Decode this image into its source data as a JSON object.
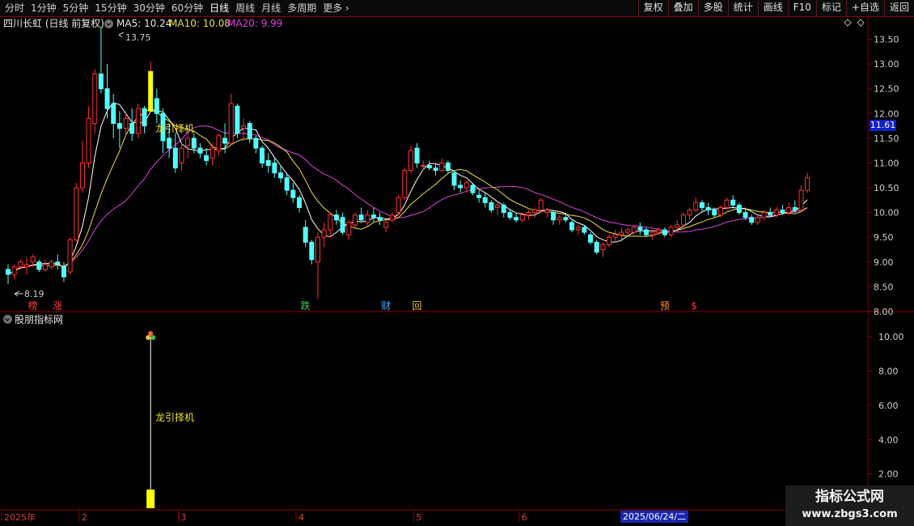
{
  "toolbar": {
    "periods": [
      "分时",
      "1分钟",
      "5分钟",
      "15分钟",
      "30分钟",
      "60分钟",
      "日线",
      "周线",
      "月线",
      "多周期",
      "更多"
    ],
    "active_period": "日线",
    "tools": [
      "复权",
      "叠加",
      "多股",
      "统计",
      "画线",
      "F10",
      "标记",
      "+自选",
      "返回"
    ]
  },
  "header": {
    "stock_title": "四川长虹 (日线 前复权)",
    "ma5": "MA5: 10.24",
    "ma10": "MA10: 10.08",
    "ma20": "MA20: 9.99"
  },
  "main": {
    "max_label": "13.75",
    "min_label": "8.19",
    "annotation": "龙引择机",
    "price_tag": "11.61",
    "markers": [
      {
        "char": "榜",
        "color": "#ff4040",
        "i": 4
      },
      {
        "char": "涨",
        "color": "#ff4040",
        "i": 8
      },
      {
        "char": "跌",
        "color": "#44d050",
        "i": 48
      },
      {
        "char": "财",
        "color": "#44aaff",
        "i": 61
      },
      {
        "char": "回",
        "color": "#e8c040",
        "i": 66
      },
      {
        "char": "预",
        "color": "#ff9030",
        "i": 106
      },
      {
        "char": "$",
        "color": "#ff3030",
        "i": 111
      }
    ]
  },
  "sub": {
    "title": "股朋指标网",
    "annotation": "龙引择机",
    "signal_i": 23
  },
  "axis": {
    "date_labels": [
      {
        "text": "2025年",
        "i": 0
      },
      {
        "text": "2",
        "i": 12
      },
      {
        "text": "3",
        "i": 28
      },
      {
        "text": "4",
        "i": 47
      },
      {
        "text": "5",
        "i": 66
      },
      {
        "text": "6",
        "i": 83
      }
    ],
    "date_badge": "2025/06/24/二"
  },
  "watermark": {
    "title": "指标公式网",
    "url": "www.zbgs3.com"
  },
  "colors": {
    "up": "#ff3232",
    "down": "#54fcfc",
    "ma5": "#ffffff",
    "ma10": "#f0e040",
    "ma20": "#e040e0",
    "grid": "#8b0000",
    "signal": "#ffff00"
  },
  "chart_data": {
    "type": "candlestick",
    "price_axis": {
      "ticks": [
        8.0,
        8.5,
        9.0,
        9.5,
        10.0,
        10.5,
        11.0,
        11.5,
        12.0,
        12.5,
        13.0,
        13.5
      ],
      "range": [
        7.95,
        13.95
      ]
    },
    "indicator_axis": {
      "ticks": [
        2.0,
        4.0,
        6.0,
        8.0,
        10.0
      ],
      "range": [
        0,
        11
      ]
    },
    "signal_value": 10,
    "candles": [
      [
        8.85,
        8.95,
        8.55,
        8.75
      ],
      [
        8.75,
        8.95,
        8.65,
        8.9
      ],
      [
        8.9,
        9.05,
        8.85,
        9.0
      ],
      [
        8.9,
        9.1,
        8.75,
        8.95
      ],
      [
        9.0,
        9.15,
        8.9,
        9.1
      ],
      [
        9.0,
        9.05,
        8.8,
        8.85
      ],
      [
        8.85,
        9.05,
        8.8,
        8.95
      ],
      [
        8.9,
        9.05,
        8.85,
        9.0
      ],
      [
        9.0,
        9.15,
        8.85,
        8.95
      ],
      [
        8.9,
        9.0,
        8.6,
        8.7
      ],
      [
        8.8,
        9.5,
        8.75,
        9.45
      ],
      [
        9.45,
        10.6,
        9.4,
        10.5
      ],
      [
        10.5,
        11.45,
        10.4,
        11.0
      ],
      [
        11.0,
        12.15,
        10.9,
        11.9
      ],
      [
        11.8,
        12.9,
        11.6,
        12.8
      ],
      [
        12.8,
        13.75,
        12.4,
        12.5
      ],
      [
        12.5,
        13.0,
        11.9,
        12.1
      ],
      [
        12.2,
        12.4,
        11.5,
        11.8
      ],
      [
        11.8,
        12.05,
        11.3,
        11.7
      ],
      [
        11.7,
        12.05,
        11.55,
        11.9
      ],
      [
        11.8,
        12.1,
        11.45,
        11.6
      ],
      [
        11.6,
        12.2,
        11.5,
        12.1
      ],
      [
        12.1,
        12.15,
        11.6,
        11.75
      ],
      [
        12.05,
        13.05,
        12.05,
        12.85
      ],
      [
        12.3,
        12.5,
        11.8,
        12.0
      ],
      [
        12.0,
        12.1,
        11.2,
        11.45
      ],
      [
        11.5,
        11.8,
        11.1,
        11.3
      ],
      [
        11.3,
        11.6,
        10.8,
        10.9
      ],
      [
        11.0,
        11.4,
        10.85,
        11.3
      ],
      [
        11.35,
        11.6,
        11.1,
        11.5
      ],
      [
        11.5,
        11.6,
        11.2,
        11.3
      ],
      [
        11.3,
        11.4,
        11.1,
        11.2
      ],
      [
        11.15,
        11.3,
        10.95,
        11.05
      ],
      [
        11.1,
        11.4,
        10.95,
        11.3
      ],
      [
        11.25,
        11.6,
        11.15,
        11.55
      ],
      [
        11.5,
        11.8,
        11.2,
        11.4
      ],
      [
        11.4,
        12.4,
        11.35,
        12.2
      ],
      [
        12.15,
        12.2,
        11.5,
        11.6
      ],
      [
        11.7,
        11.9,
        11.45,
        11.75
      ],
      [
        11.8,
        11.85,
        11.4,
        11.5
      ],
      [
        11.5,
        11.55,
        11.2,
        11.3
      ],
      [
        11.3,
        11.35,
        10.9,
        11.0
      ],
      [
        11.05,
        11.2,
        10.8,
        10.95
      ],
      [
        11.0,
        11.1,
        10.7,
        10.8
      ],
      [
        10.8,
        10.95,
        10.6,
        10.7
      ],
      [
        10.7,
        10.8,
        10.35,
        10.45
      ],
      [
        10.45,
        10.6,
        10.2,
        10.3
      ],
      [
        10.3,
        10.35,
        10.0,
        10.1
      ],
      [
        9.7,
        9.85,
        9.3,
        9.4
      ],
      [
        9.4,
        9.45,
        8.95,
        9.05
      ],
      [
        9.0,
        9.6,
        8.25,
        9.5
      ],
      [
        9.5,
        9.8,
        9.3,
        9.65
      ],
      [
        9.65,
        10.0,
        9.5,
        9.95
      ],
      [
        9.95,
        10.05,
        9.75,
        9.85
      ],
      [
        9.9,
        10.0,
        9.55,
        9.6
      ],
      [
        9.55,
        9.85,
        9.45,
        9.8
      ],
      [
        9.75,
        10.0,
        9.7,
        9.95
      ],
      [
        9.95,
        10.1,
        9.8,
        9.85
      ],
      [
        9.8,
        10.05,
        9.7,
        9.95
      ],
      [
        9.95,
        10.1,
        9.8,
        9.9
      ],
      [
        9.9,
        10.0,
        9.75,
        9.85
      ],
      [
        9.7,
        9.85,
        9.6,
        9.8
      ],
      [
        9.85,
        10.0,
        9.8,
        9.95
      ],
      [
        10.0,
        10.35,
        9.95,
        10.3
      ],
      [
        10.3,
        10.9,
        10.25,
        10.85
      ],
      [
        10.85,
        11.35,
        10.8,
        11.25
      ],
      [
        11.3,
        11.4,
        10.9,
        11.0
      ],
      [
        10.95,
        11.05,
        10.85,
        10.95
      ],
      [
        10.95,
        11.05,
        10.85,
        10.9
      ],
      [
        10.9,
        11.0,
        10.75,
        10.85
      ],
      [
        10.85,
        11.1,
        10.8,
        11.0
      ],
      [
        11.0,
        11.05,
        10.8,
        10.85
      ],
      [
        10.8,
        10.85,
        10.45,
        10.55
      ],
      [
        10.55,
        10.65,
        10.4,
        10.5
      ],
      [
        10.5,
        10.65,
        10.4,
        10.6
      ],
      [
        10.55,
        10.6,
        10.35,
        10.4
      ],
      [
        10.35,
        10.45,
        10.2,
        10.3
      ],
      [
        10.3,
        10.4,
        10.1,
        10.2
      ],
      [
        10.2,
        10.25,
        10.0,
        10.05
      ],
      [
        10.1,
        10.2,
        9.95,
        10.15
      ],
      [
        10.15,
        10.2,
        9.9,
        10.0
      ],
      [
        10.0,
        10.05,
        9.85,
        9.9
      ],
      [
        9.9,
        10.0,
        9.8,
        9.85
      ],
      [
        9.85,
        10.0,
        9.8,
        9.95
      ],
      [
        9.95,
        10.05,
        9.85,
        10.0
      ],
      [
        10.0,
        10.1,
        9.9,
        10.05
      ],
      [
        10.05,
        10.3,
        10.0,
        10.25
      ],
      [
        10.0,
        10.1,
        9.9,
        10.05
      ],
      [
        10.0,
        10.05,
        9.75,
        9.85
      ],
      [
        9.85,
        9.95,
        9.75,
        9.9
      ],
      [
        9.9,
        10.0,
        9.8,
        9.85
      ],
      [
        9.8,
        9.85,
        9.6,
        9.65
      ],
      [
        9.65,
        9.75,
        9.55,
        9.7
      ],
      [
        9.7,
        9.75,
        9.55,
        9.6
      ],
      [
        9.55,
        9.6,
        9.35,
        9.4
      ],
      [
        9.4,
        9.45,
        9.15,
        9.2
      ],
      [
        9.25,
        9.4,
        9.1,
        9.35
      ],
      [
        9.35,
        9.55,
        9.3,
        9.5
      ],
      [
        9.5,
        9.65,
        9.4,
        9.55
      ],
      [
        9.55,
        9.7,
        9.45,
        9.6
      ],
      [
        9.6,
        9.7,
        9.5,
        9.65
      ],
      [
        9.6,
        9.75,
        9.55,
        9.7
      ],
      [
        9.7,
        9.8,
        9.55,
        9.65
      ],
      [
        9.65,
        9.7,
        9.5,
        9.55
      ],
      [
        9.55,
        9.65,
        9.45,
        9.6
      ],
      [
        9.6,
        9.7,
        9.55,
        9.65
      ],
      [
        9.65,
        9.7,
        9.5,
        9.55
      ],
      [
        9.55,
        9.75,
        9.5,
        9.7
      ],
      [
        9.7,
        9.85,
        9.6,
        9.75
      ],
      [
        9.75,
        10.0,
        9.7,
        9.95
      ],
      [
        9.95,
        10.1,
        9.85,
        10.05
      ],
      [
        10.05,
        10.3,
        10.0,
        10.2
      ],
      [
        10.2,
        10.25,
        10.0,
        10.1
      ],
      [
        10.1,
        10.2,
        9.95,
        10.05
      ],
      [
        10.05,
        10.1,
        9.9,
        9.95
      ],
      [
        9.95,
        10.15,
        9.9,
        10.1
      ],
      [
        10.1,
        10.3,
        10.05,
        10.25
      ],
      [
        10.25,
        10.35,
        10.1,
        10.15
      ],
      [
        10.15,
        10.2,
        9.95,
        10.0
      ],
      [
        10.0,
        10.1,
        9.85,
        9.9
      ],
      [
        9.9,
        9.95,
        9.75,
        9.8
      ],
      [
        9.8,
        9.95,
        9.75,
        9.9
      ],
      [
        9.9,
        10.05,
        9.85,
        10.0
      ],
      [
        10.0,
        10.1,
        9.9,
        9.95
      ],
      [
        9.95,
        10.1,
        9.9,
        10.05
      ],
      [
        10.05,
        10.15,
        9.95,
        10.0
      ],
      [
        10.0,
        10.2,
        9.95,
        10.1
      ],
      [
        10.1,
        10.25,
        10.0,
        10.05
      ],
      [
        10.05,
        10.55,
        10.0,
        10.45
      ],
      [
        10.45,
        10.8,
        10.4,
        10.7
      ]
    ]
  }
}
